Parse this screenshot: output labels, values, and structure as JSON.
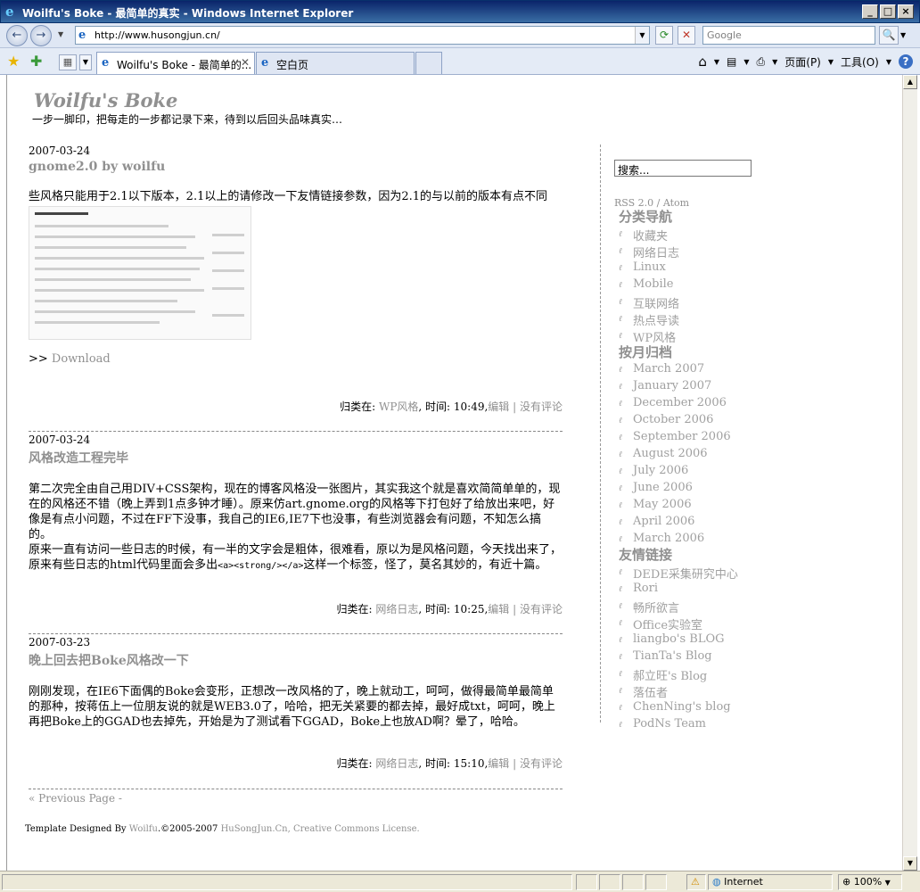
{
  "window": {
    "title": "Woilfu's Boke - 最简单的真实 - Windows Internet Explorer",
    "minimize": "_",
    "maximize": "□",
    "close": "×"
  },
  "nav": {
    "back": "←",
    "forward": "→",
    "url": "http://www.husongjun.cn/",
    "refresh": "⟳",
    "stop": "✕",
    "search_placeholder": "Google",
    "search_go": "🔍"
  },
  "tabs": [
    {
      "label": "Woilfu's Boke - 最简单的..."
    },
    {
      "label": "空白页"
    }
  ],
  "toolbar": {
    "home": "⌂",
    "feeds": "▤",
    "print": "⎙",
    "page": "页面(P)",
    "tools": "工具(O)",
    "help": "?"
  },
  "blog": {
    "title": "Woilfu's Boke",
    "description": "一步一脚印，把每走的一步都记录下来，待到以后回头品味真实…"
  },
  "posts": [
    {
      "date": "2007-03-24",
      "title": "gnome2.0 by woilfu",
      "body": "些风格只能用于2.1以下版本，2.1以上的请修改一下友情链接参数，因为2.1的与以前的版本有点不同",
      "download_prefix": ">> ",
      "download": "Download",
      "meta_prefix": "归类在: ",
      "category": "WP风格",
      "time_label": ", 时间: 10:49,",
      "edit": "编辑",
      "pipe": " | ",
      "comments": "没有评论"
    },
    {
      "date": "2007-03-24",
      "title": "风格改造工程完毕",
      "body1": "第二次完全由自己用DIV+CSS架构，现在的博客风格没一张图片，其实我这个就是喜欢简简单单的，现在的风格还不错（晚上弄到1点多钟才睡）。原来仿art.gnome.org的风格等下打包好了给放出来吧，好像是有点小问题，不过在FF下没事，我自己的IE6,IE7下也没事，有些浏览器会有问题，不知怎么搞的。",
      "body2a": "原来一直有访问一些日志的时候，有一半的文字会是粗体，很难看，原以为是风格问题，今天找出来了，原来有些日志的html代码里面会多出",
      "code": "<a><strong/></a>",
      "body2b": "这样一个标签，怪了，莫名其妙的，有近十篇。",
      "meta_prefix": "归类在: ",
      "category": "网络日志",
      "time_label": ", 时间: 10:25,",
      "edit": "编辑",
      "pipe": " | ",
      "comments": "没有评论"
    },
    {
      "date": "2007-03-23",
      "title": "晚上回去把Boke风格改一下",
      "body": "刚刚发现，在IE6下面偶的Boke会变形，正想改一改风格的了，晚上就动工，呵呵，做得最简单最简单的那种，按蒋伍上一位朋友说的就是WEB3.0了，哈哈，把无关紧要的都去掉，最好成txt，呵呵，晚上再把Boke上的GGAD也去掉先，开始是为了测试看下GGAD，Boke上也放AD啊？晕了，哈哈。",
      "meta_prefix": "归类在: ",
      "category": "网络日志",
      "time_label": ", 时间: 15:10,",
      "edit": "编辑",
      "pipe": " | ",
      "comments": "没有评论"
    }
  ],
  "pagination": {
    "prev": "« Previous Page",
    "sep": " -"
  },
  "footer": {
    "prefix": "Template Designed By ",
    "author": "Woilfu",
    "copy": ".©2005-2007 ",
    "site": "HuSongJun.Cn",
    "sep": ", ",
    "license": "Creative Commons License",
    "end": "."
  },
  "sidebar": {
    "search_value": "搜索...",
    "rss": "RSS 2.0 / Atom",
    "categories_heading": "分类导航",
    "categories": [
      "收藏夹",
      "网络日志",
      "Linux",
      "Mobile",
      "互联网络",
      "热点导读",
      "WP风格"
    ],
    "archives_heading": "按月归档",
    "archives": [
      "March 2007",
      "January 2007",
      "December 2006",
      "October 2006",
      "September 2006",
      "August 2006",
      "July 2006",
      "June 2006",
      "May 2006",
      "April 2006",
      "March 2006"
    ],
    "links_heading": "友情链接",
    "links": [
      "DEDE采集研究中心",
      "Rori",
      "畅所欲言",
      "Office实验室",
      "liangbo's BLOG",
      "TianTa's Blog",
      "郝立旺's Blog",
      "落伍者",
      "ChenNing's blog",
      "PodNs Team"
    ]
  },
  "status": {
    "zone": "Internet",
    "zoom": "100%"
  }
}
